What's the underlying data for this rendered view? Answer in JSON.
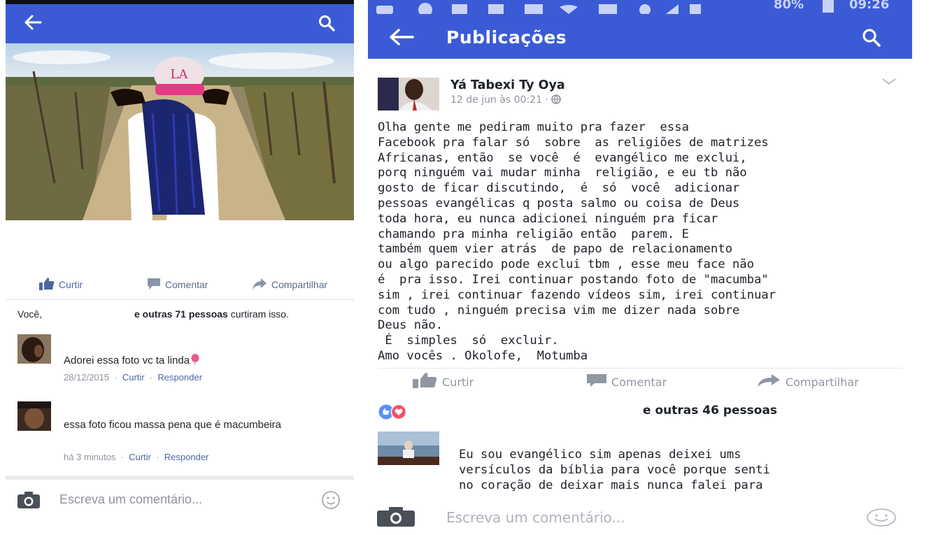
{
  "left": {
    "reactions": {
      "like": "Curtir",
      "comment": "Comentar",
      "share": "Compartilhar"
    },
    "likes_summary": {
      "you": "Você,",
      "others": "e outras 71 pessoas",
      "suffix": " curtiram isso."
    },
    "comments": [
      {
        "text": "Adorei essa foto vc ta linda",
        "date": "28/12/2015",
        "like": "Curtir",
        "reply": "Responder"
      },
      {
        "text": "essa foto ficou massa pena que é macumbeira",
        "date": "há 3 minutos",
        "like": "Curtir",
        "reply": "Responder"
      }
    ],
    "comment_input_placeholder": "Escreva um comentário..."
  },
  "right": {
    "status_bar": {
      "battery": "80%",
      "time": "09:26"
    },
    "title": "Publicações",
    "post": {
      "author": "Yá Tabexi Ty Oya",
      "timestamp": "12 de jun às 00:21 · ",
      "body": "Olha gente me pediram muito pra fazer  essa\nFacebook pra falar só  sobre  as religiões de matrizes\nAfricanas, então  se você  é  evangélico me exclui,\nporq ninguém vai mudar minha  religião, e eu tb não\ngosto de ficar discutindo,  é  só  você  adicionar\npessoas evangélicas q posta salmo ou coisa de Deus\ntoda hora, eu nunca adicionei ninguém pra ficar\nchamando pra minha religião então  parem. E\ntambém quem vier atrás  de papo de relacionamento\nou algo parecido pode exclui tbm , esse meu face não\né  pra isso. Irei continuar postando foto de \"macumba\"\nsim , irei continuar fazendo vídeos sim, irei continuar\ncom tudo , ninguém precisa vim me dizer nada sobre\nDeus não.\n É  simples  só  excluir.\nAmo vocês . Okolofe,  Motumba"
    },
    "reactions": {
      "like": "Curtir",
      "comment": "Comentar",
      "share": "Compartilhar"
    },
    "likes_summary": "e outras 46 pessoas",
    "comment": {
      "text": "Eu sou evangélico sim apenas deixei ums\nversículos da bíblia para você porque senti\nno coração de deixar mais nunca falei para"
    },
    "comment_input_placeholder": "Escreva um comentário..."
  },
  "colors": {
    "appbar": "#3b5bd6",
    "link": "#4b67a1",
    "action": "#5a6a8c",
    "meta": "#8d949e"
  }
}
